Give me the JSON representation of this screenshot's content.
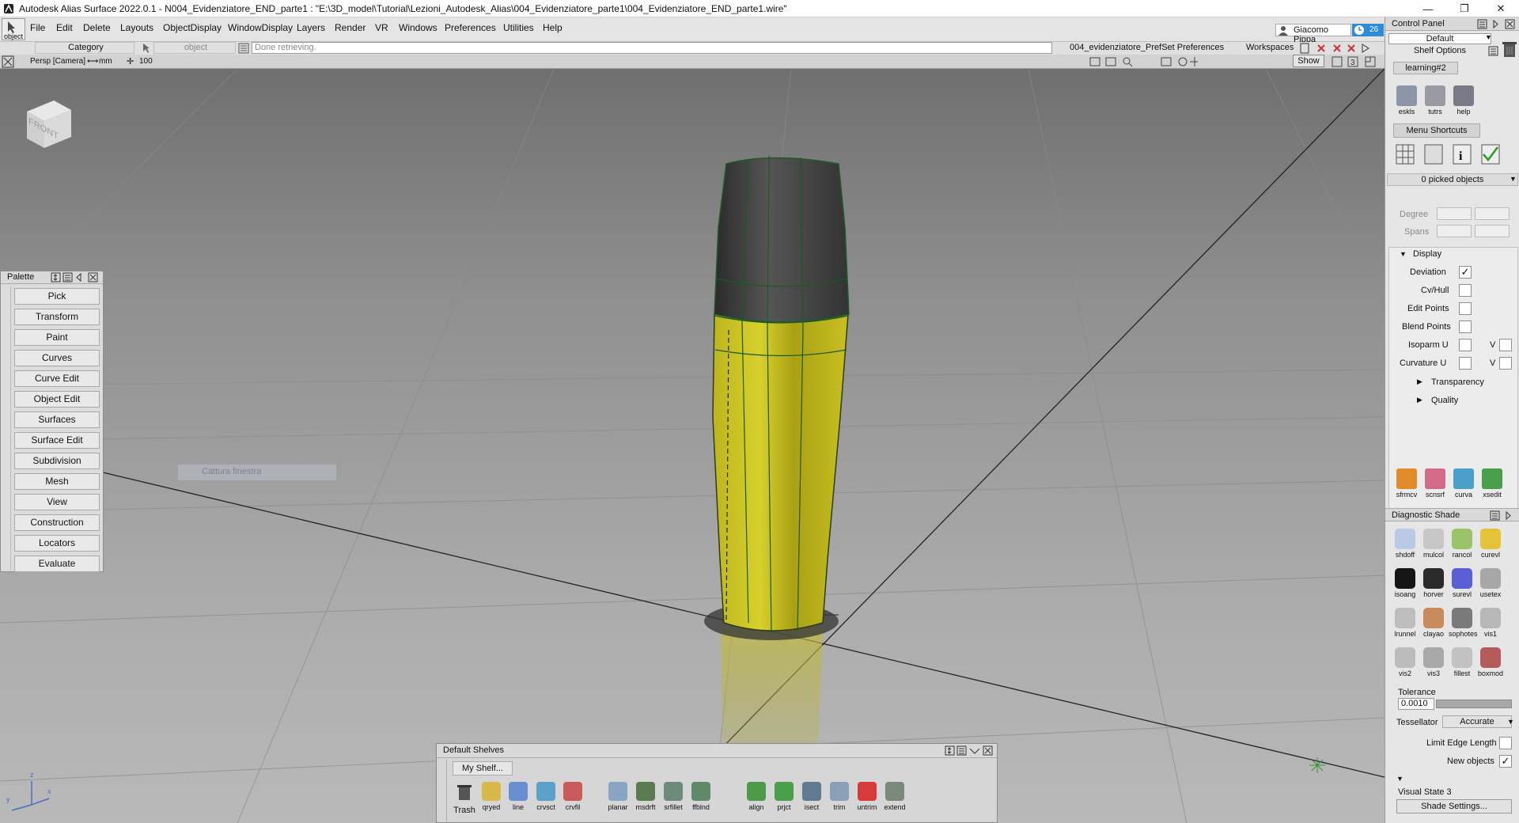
{
  "titlebar": {
    "title": "Autodesk Alias Surface 2022.0.1   - N004_Evidenziatore_END_parte1 : \"E:\\3D_model\\Tutorial\\Lezioni_Autodesk_Alias\\004_Evidenziatore_parte1\\004_Evidenziatore_END_parte1.wire\"",
    "minimize": "—",
    "restore": "❐",
    "close": "✕"
  },
  "menubar": {
    "items": [
      "File",
      "Edit",
      "Delete",
      "Layouts",
      "ObjectDisplay",
      "WindowDisplay",
      "Layers",
      "Render",
      "VR",
      "Windows",
      "Preferences",
      "Utilities",
      "Help"
    ],
    "object_label": "object",
    "category": "Category",
    "object_field": "object",
    "status": "Done retrieving.",
    "prefset": "004_evidenziatore_PrefSet Preferences",
    "workspaces": "Workspaces",
    "user": "Giacomo Pippa",
    "badge": "26"
  },
  "viewport": {
    "camera": "Persp [Camera]",
    "units": "mm",
    "grid": "100",
    "show_label": "Show",
    "cube_face": "FRONT",
    "ghost_text": "Cattura finestra",
    "axis_x": "x",
    "axis_y": "y",
    "axis_z": "z"
  },
  "palette": {
    "title": "Palette",
    "items": [
      "Pick",
      "Transform",
      "Paint",
      "Curves",
      "Curve Edit",
      "Object Edit",
      "Surfaces",
      "Surface Edit",
      "Subdivision",
      "Mesh",
      "View",
      "Construction",
      "Locators",
      "Evaluate"
    ]
  },
  "control_panel": {
    "title": "Control Panel",
    "preset": "Default",
    "shelf_options": "Shelf Options",
    "shelf_tab": "learning#2",
    "top_icons": [
      {
        "label": "eskls",
        "icon": "eskls-icon"
      },
      {
        "label": "tutrs",
        "icon": "tutrs-icon"
      },
      {
        "label": "help",
        "icon": "help-icon"
      }
    ],
    "menu_shortcuts": "Menu Shortcuts",
    "picked": "0 picked objects",
    "degree": "Degree",
    "spans": "Spans",
    "display": {
      "header": "Display",
      "rows": [
        {
          "label": "Deviation",
          "checked": "✓"
        },
        {
          "label": "Cv/Hull",
          "checked": ""
        },
        {
          "label": "Edit Points",
          "checked": ""
        },
        {
          "label": "Blend Points",
          "checked": ""
        },
        {
          "label": "Isoparm U",
          "checked": "",
          "v": "V"
        },
        {
          "label": "Curvature U",
          "checked": "",
          "v": "V"
        }
      ],
      "transparency": "Transparency",
      "quality": "Quality"
    },
    "tool_icons": [
      {
        "label": "sfrmcv",
        "icon": "sfrmcv-icon"
      },
      {
        "label": "scnsrf",
        "icon": "scnsrf-icon"
      },
      {
        "label": "curva",
        "icon": "curva-icon"
      },
      {
        "label": "xsedit",
        "icon": "xsedit-icon"
      }
    ],
    "diag": {
      "title": "Diagnostic Shade",
      "icons": [
        {
          "label": "shdoff",
          "c": "#b9c9e6"
        },
        {
          "label": "mulcol",
          "c": "#c7c7c7"
        },
        {
          "label": "rancol",
          "c": "#9bc36a"
        },
        {
          "label": "curevl",
          "c": "#e4c23a"
        },
        {
          "label": "isoang",
          "c": "#151515"
        },
        {
          "label": "horver",
          "c": "#2a2a2a"
        },
        {
          "label": "surevl",
          "c": "#5b5fd6"
        },
        {
          "label": "usetex",
          "c": "#a7a7a7"
        },
        {
          "label": "lrunnel",
          "c": "#bdbdbd"
        },
        {
          "label": "clayao",
          "c": "#c98b5c"
        },
        {
          "label": "sophotes",
          "c": "#7a7a7a"
        },
        {
          "label": "vis1",
          "c": "#b7b7b7"
        },
        {
          "label": "vis2",
          "c": "#bcbcbc"
        },
        {
          "label": "vis3",
          "c": "#a9a9a9"
        },
        {
          "label": "fillest",
          "c": "#c2c2c2"
        },
        {
          "label": "boxmod",
          "c": "#b55a5a"
        }
      ],
      "tolerance": "Tolerance",
      "tolerance_val": "0.0010",
      "tessellator": "Tessellator",
      "tess_val": "Accurate",
      "limit": "Limit Edge Length",
      "new_objects": "New objects",
      "new_checked": "✓",
      "visual_state": "Visual State 3",
      "shade_settings": "Shade Settings..."
    }
  },
  "shelf": {
    "title": "Default Shelves",
    "tab": "My Shelf...",
    "trash": "Trash",
    "items": [
      {
        "label": "qryed",
        "c": "#d9b84a"
      },
      {
        "label": "line",
        "c": "#6a8fd0"
      },
      {
        "label": "crvsct",
        "c": "#5aa0c8"
      },
      {
        "label": "crvfil",
        "c": "#c85a5a"
      },
      {
        "label": "planar",
        "c": "#8aa4c4"
      },
      {
        "label": "msdrft",
        "c": "#5b7a52"
      },
      {
        "label": "srfillet",
        "c": "#6d8b7a"
      },
      {
        "label": "ffblnd",
        "c": "#5f8a6a"
      },
      {
        "label": "align",
        "c": "#4f9a4a"
      },
      {
        "label": "prjct",
        "c": "#4aa04a"
      },
      {
        "label": "isect",
        "c": "#607a90"
      },
      {
        "label": "trim",
        "c": "#8aa0b4"
      },
      {
        "label": "untrim",
        "c": "#d63a3a"
      },
      {
        "label": "extend",
        "c": "#7a8a7a"
      }
    ]
  }
}
